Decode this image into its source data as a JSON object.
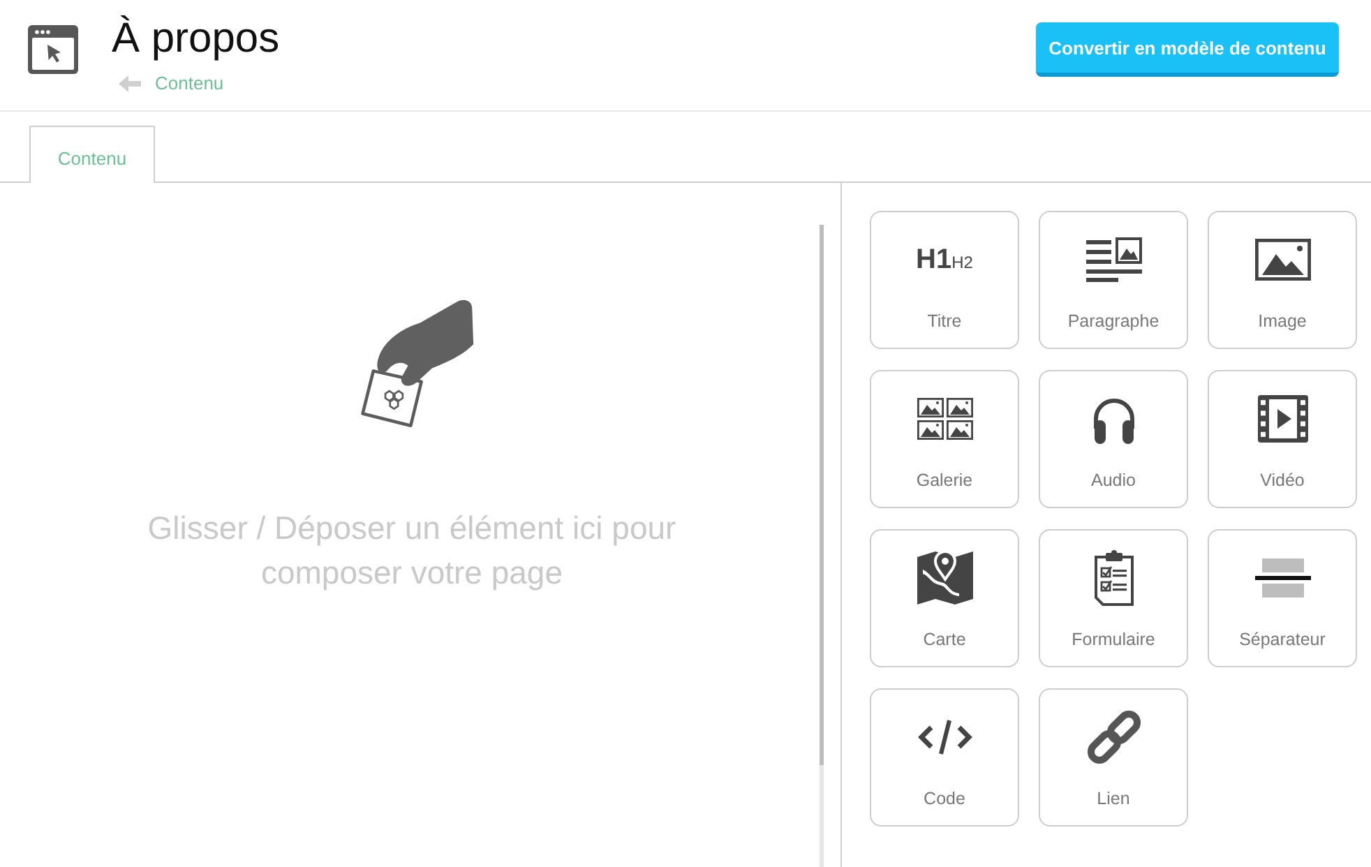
{
  "header": {
    "title": "À propos",
    "breadcrumb": {
      "label": "Contenu"
    },
    "button": "Convertir en modèle de contenu"
  },
  "tabs": [
    {
      "label": "Contenu",
      "selected": true
    }
  ],
  "dropzone": {
    "text": "Glisser / Déposer un élément ici pour composer votre page"
  },
  "blocks": [
    {
      "kind": "heading",
      "glyph": "H1",
      "glyph_small": "H2",
      "label": "Titre"
    },
    {
      "kind": "paragraph",
      "label": "Paragraphe"
    },
    {
      "kind": "image",
      "label": "Image"
    },
    {
      "kind": "gallery",
      "label": "Galerie"
    },
    {
      "kind": "audio",
      "label": "Audio"
    },
    {
      "kind": "video",
      "label": "Vidéo"
    },
    {
      "kind": "map",
      "label": "Carte"
    },
    {
      "kind": "form",
      "label": "Formulaire"
    },
    {
      "kind": "separator",
      "label": "Séparateur"
    },
    {
      "kind": "code",
      "label": "Code"
    },
    {
      "kind": "link",
      "label": "Lien"
    }
  ]
}
